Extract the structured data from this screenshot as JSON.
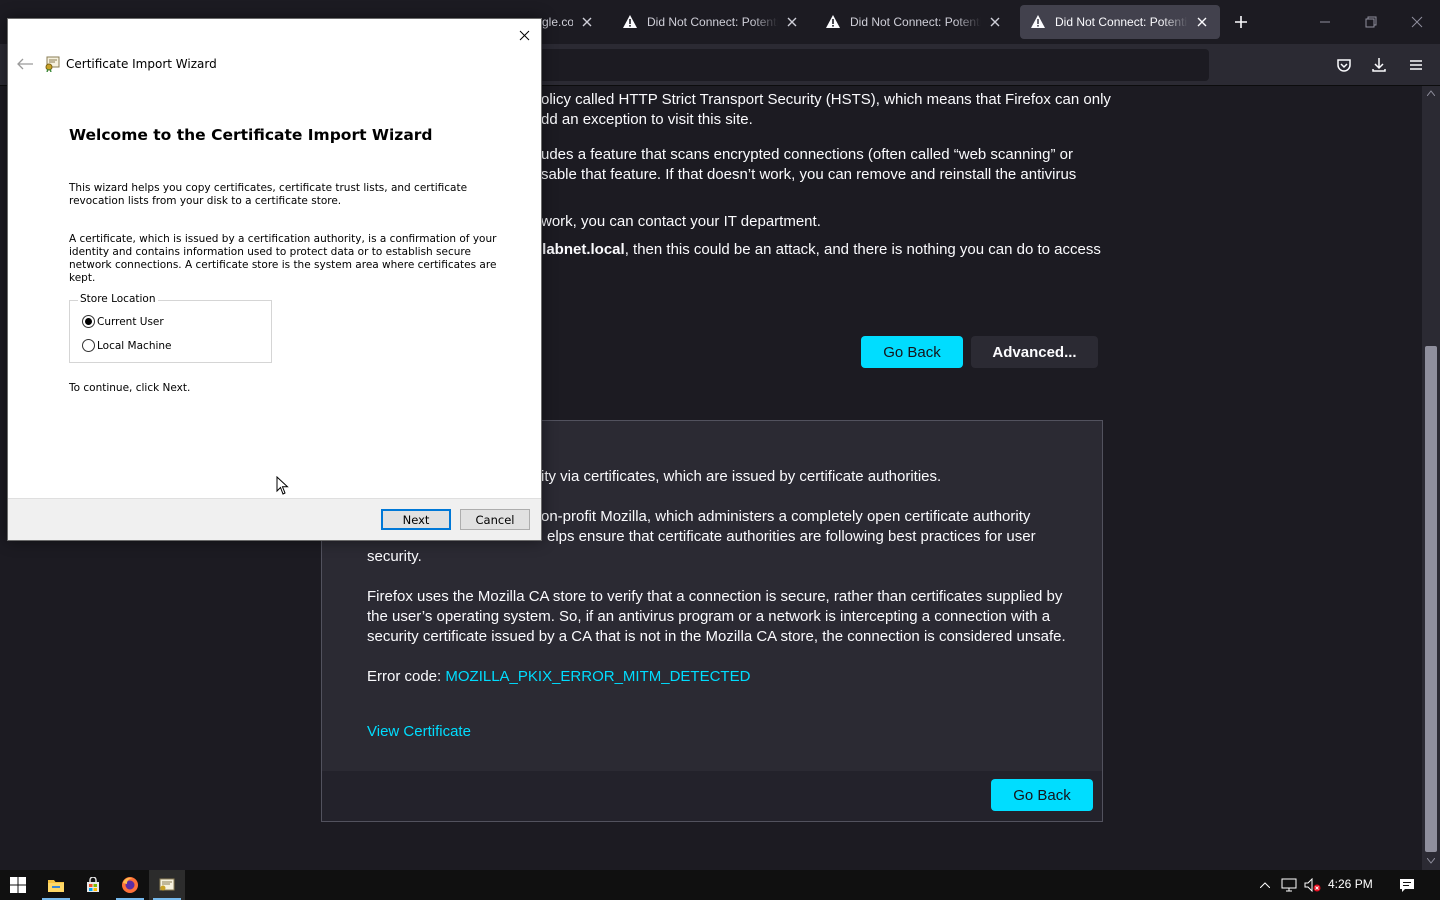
{
  "tabs": [
    {
      "title": "gle.com",
      "active": false
    },
    {
      "title": "Did Not Connect: Potential",
      "active": false
    },
    {
      "title": "Did Not Connect: Potential",
      "active": false
    },
    {
      "title": "Did Not Connect: Potential",
      "active": true
    }
  ],
  "page": {
    "para1_line1": "olicy called HTTP Strict Transport Security (HSTS), which means that Firefox can only",
    "para1_line2": "dd an exception to visit this site.",
    "para2_line1": "udes a feature that scans encrypted connections (often called “web scanning” or",
    "para2_line2": "sable that feature. If that doesn’t work, you can remove and reinstall the antivirus",
    "para3": "work, you can contact your IT department.",
    "para4_bold": "llabnet.local",
    "para4_rest": ", then this could be an attack, and there is nothing you can do to access",
    "go_back_label": "Go Back",
    "advanced_label": "Advanced...",
    "adv_para1": "ity via certificates, which are issued by certificate authorities.",
    "adv_para2_line1": "on-profit Mozilla, which administers a completely open certificate authority",
    "adv_para2_line2": "elps ensure that certificate authorities are following best practices for user",
    "adv_para2_line3": "security.",
    "adv_para3": "Firefox uses the Mozilla CA store to verify that a connection is secure, rather than certificates supplied by the user’s operating system. So, if an antivirus program or a network is intercepting a connection with a security certificate issued by a CA that is not in the Mozilla CA store, the connection is considered unsafe.",
    "error_code_label": "Error code: ",
    "error_code": "MOZILLA_PKIX_ERROR_MITM_DETECTED",
    "view_certificate_label": "View Certificate",
    "go_back_label_2": "Go Back"
  },
  "wizard": {
    "window_title": "Certificate Import Wizard",
    "heading": "Welcome to the Certificate Import Wizard",
    "intro": "This wizard helps you copy certificates, certificate trust lists, and certificate revocation lists from your disk to a certificate store.",
    "description": "A certificate, which is issued by a certification authority, is a confirmation of your identity and contains information used to protect data or to establish secure network connections. A certificate store is the system area where certificates are kept.",
    "store_location_label": "Store Location",
    "options": [
      {
        "label": "Current User",
        "selected": true
      },
      {
        "label": "Local Machine",
        "selected": false
      }
    ],
    "continue_text": "To continue, click Next.",
    "next_label": "Next",
    "cancel_label": "Cancel"
  },
  "taskbar": {
    "clock": "4:26 PM"
  },
  "colors": {
    "accent": "#00ddff",
    "page_bg": "#1c1b22",
    "panel_bg": "#2b2a33"
  }
}
